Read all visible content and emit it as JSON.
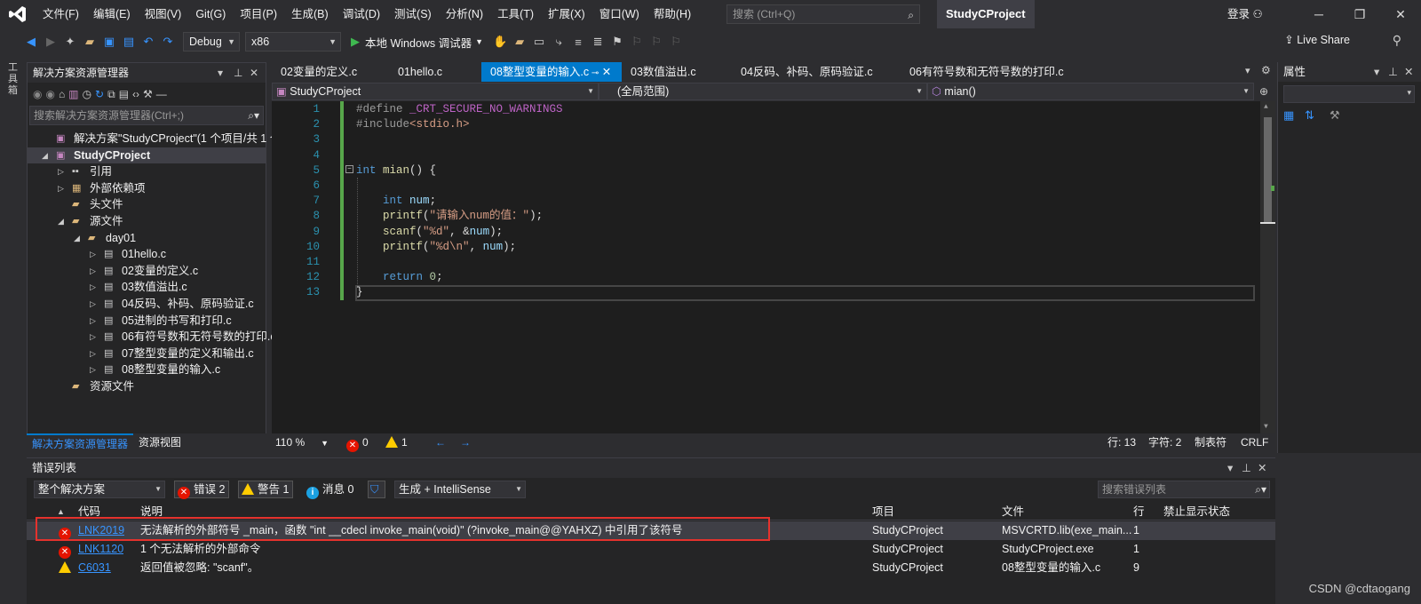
{
  "menubar": {
    "items": [
      "文件(F)",
      "编辑(E)",
      "视图(V)",
      "Git(G)",
      "项目(P)",
      "生成(B)",
      "调试(D)",
      "测试(S)",
      "分析(N)",
      "工具(T)",
      "扩展(X)",
      "窗口(W)",
      "帮助(H)"
    ],
    "search_placeholder": "搜索 (Ctrl+Q)",
    "project_title": "StudyCProject",
    "login": "登录"
  },
  "toolbar": {
    "config": "Debug",
    "platform": "x86",
    "run_label": "本地 Windows 调试器",
    "live_share": "Live Share"
  },
  "left_strip": {
    "label": "工具箱"
  },
  "solution_explorer": {
    "title": "解决方案资源管理器",
    "search_placeholder": "搜索解决方案资源管理器(Ctrl+;)",
    "tree": [
      {
        "label": "解决方案\"StudyCProject\"(1 个项目/共 1 个)",
        "level": 0,
        "icon": "solution-icon",
        "expander": "none"
      },
      {
        "label": "StudyCProject",
        "level": 0,
        "icon": "project-icon",
        "expander": "expanded",
        "bold": true,
        "selected": true
      },
      {
        "label": "引用",
        "level": 1,
        "icon": "references-icon",
        "expander": "collapsed"
      },
      {
        "label": "外部依赖项",
        "level": 1,
        "icon": "external-deps-icon",
        "expander": "collapsed"
      },
      {
        "label": "头文件",
        "level": 1,
        "icon": "folder-icon",
        "expander": "none"
      },
      {
        "label": "源文件",
        "level": 1,
        "icon": "folder-icon",
        "expander": "expanded"
      },
      {
        "label": "day01",
        "level": 2,
        "icon": "folder-icon",
        "expander": "expanded"
      },
      {
        "label": "01hello.c",
        "level": 3,
        "icon": "c-file-icon",
        "expander": "collapsed"
      },
      {
        "label": "02变量的定义.c",
        "level": 3,
        "icon": "c-file-icon",
        "expander": "collapsed"
      },
      {
        "label": "03数值溢出.c",
        "level": 3,
        "icon": "c-file-icon",
        "expander": "collapsed"
      },
      {
        "label": "04反码、补码、原码验证.c",
        "level": 3,
        "icon": "c-file-icon",
        "expander": "collapsed"
      },
      {
        "label": "05进制的书写和打印.c",
        "level": 3,
        "icon": "c-file-icon",
        "expander": "collapsed"
      },
      {
        "label": "06有符号数和无符号数的打印.c",
        "level": 3,
        "icon": "c-file-icon",
        "expander": "collapsed"
      },
      {
        "label": "07整型变量的定义和输出.c",
        "level": 3,
        "icon": "c-file-icon",
        "expander": "collapsed"
      },
      {
        "label": "08整型变量的输入.c",
        "level": 3,
        "icon": "c-file-icon",
        "expander": "collapsed"
      },
      {
        "label": "资源文件",
        "level": 1,
        "icon": "folder-icon",
        "expander": "none"
      }
    ],
    "bottom_tabs": [
      "解决方案资源管理器",
      "资源视图"
    ]
  },
  "editor": {
    "tabs": [
      "02变量的定义.c",
      "01hello.c",
      "08整型变量的输入.c",
      "03数值溢出.c",
      "04反码、补码、原码验证.c",
      "06有符号数和无符号数的打印.c"
    ],
    "active_tab": "08整型变量的输入.c",
    "nav_project": "StudyCProject",
    "nav_scope": "(全局范围)",
    "nav_member": "mian()",
    "line_numbers": [
      "1",
      "2",
      "3",
      "4",
      "5",
      "6",
      "7",
      "8",
      "9",
      "10",
      "11",
      "12",
      "13"
    ],
    "lines": [
      "#define _CRT_SECURE_NO_WARNINGS",
      "#include<stdio.h>",
      "",
      "",
      "int mian() {",
      "",
      "    int num;",
      "    printf(\"请输入num的值：\");",
      "    scanf(\"%d\", &num);",
      "    printf(\"%d\\n\", num);",
      "",
      "    return 0;",
      "}"
    ],
    "status": {
      "zoom": "110 %",
      "errors": "0",
      "warnings": "1",
      "line": "行: 13",
      "char": "字符: 2",
      "tabs": "制表符",
      "eol": "CRLF"
    }
  },
  "properties": {
    "title": "属性"
  },
  "error_list": {
    "title": "错误列表",
    "scope": "整个解决方案",
    "errors_btn": "错误 2",
    "warnings_btn": "警告 1",
    "messages_btn": "消息 0",
    "build_filter": "生成 + IntelliSense",
    "search_placeholder": "搜索错误列表",
    "columns": [
      "代码",
      "说明",
      "项目",
      "文件",
      "行",
      "禁止显示状态"
    ],
    "rows": [
      {
        "severity": "error",
        "code": "LNK2019",
        "desc": "无法解析的外部符号 _main，函数 \"int __cdecl invoke_main(void)\" (?invoke_main@@YAHXZ) 中引用了该符号",
        "project": "StudyCProject",
        "file": "MSVCRTD.lib(exe_main....",
        "line": "1",
        "suppress": ""
      },
      {
        "severity": "error",
        "code": "LNK1120",
        "desc": "1 个无法解析的外部命令",
        "project": "StudyCProject",
        "file": "StudyCProject.exe",
        "line": "1",
        "suppress": ""
      },
      {
        "severity": "warning",
        "code": "C6031",
        "desc": "返回值被忽略: \"scanf\"。",
        "project": "StudyCProject",
        "file": "08整型变量的输入.c",
        "line": "9",
        "suppress": ""
      }
    ]
  },
  "watermark": "CSDN @cdtaogang"
}
